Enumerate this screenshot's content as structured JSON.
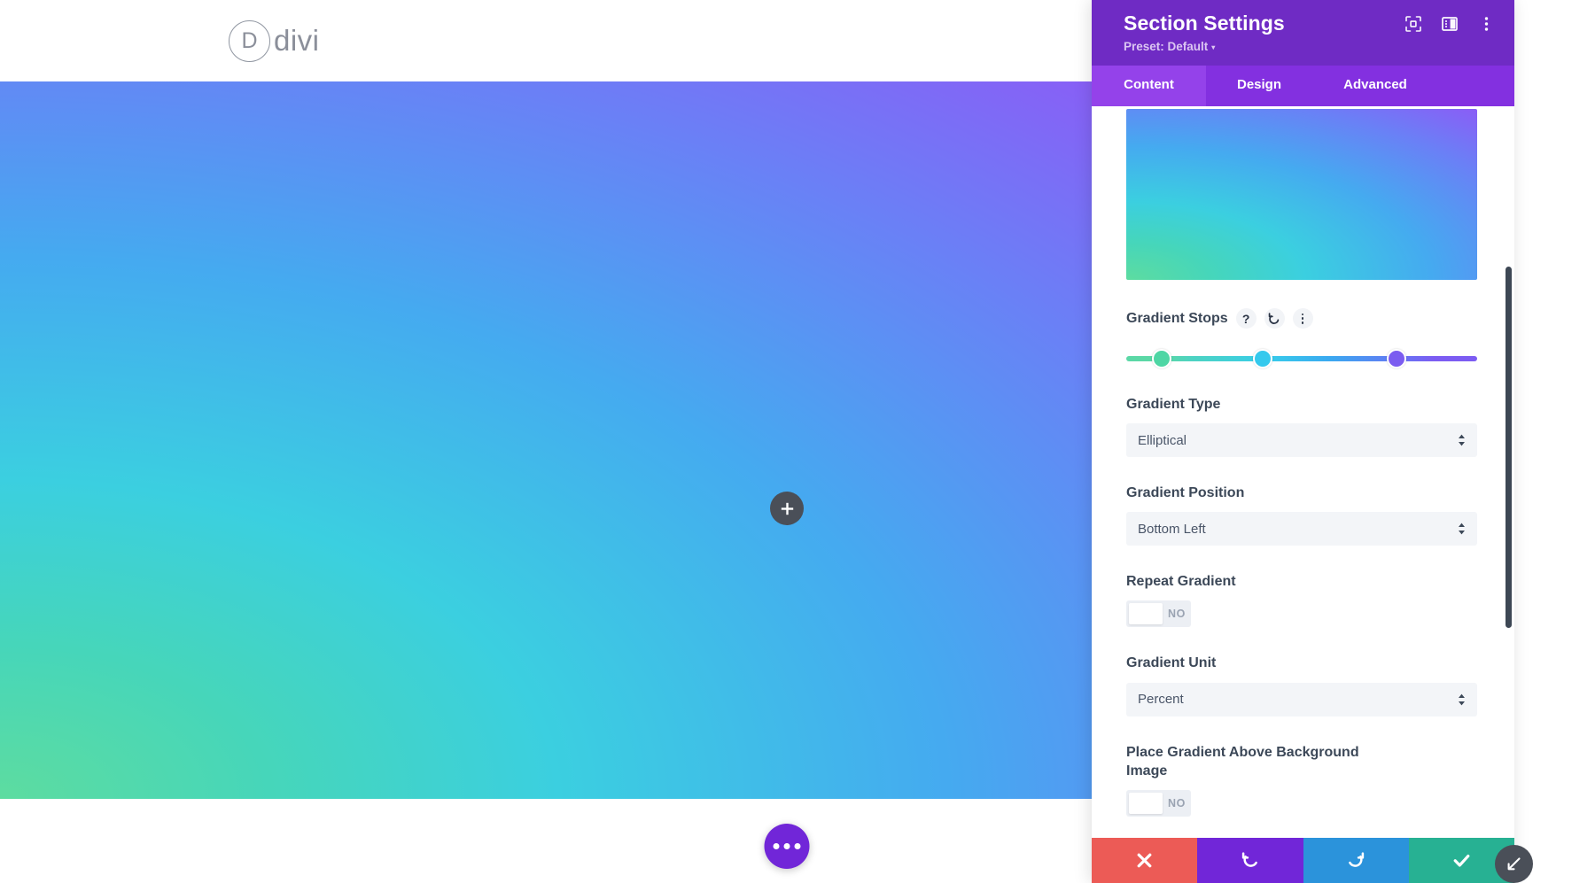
{
  "site": {
    "logo_letter": "D",
    "logo_text": "divi",
    "add_section_icon": "plus-icon",
    "page_settings_icon": "ellipsis-icon"
  },
  "modal": {
    "title": "Section Settings",
    "preset_label": "Preset: Default",
    "preset_caret": "▾",
    "header_icons": [
      {
        "name": "focus-target-icon"
      },
      {
        "name": "layout-panel-icon"
      },
      {
        "name": "vertical-dots-icon"
      }
    ],
    "tabs": [
      {
        "label": "Content",
        "active": true
      },
      {
        "label": "Design",
        "active": false
      },
      {
        "label": "Advanced",
        "active": false
      }
    ],
    "theme": {
      "header_bg": "#6f2bc4",
      "tabbar_bg": "#8330e0",
      "tab_active_bg": "#9442ea",
      "preset_text": "#dcc6f2"
    }
  },
  "gradient": {
    "preview_name": "gradient-preview-swatch",
    "stops_label": "Gradient Stops",
    "help_glyph": "?",
    "reset_glyph": "↺",
    "stops": [
      {
        "position_pct": 10,
        "color": "#4ed6a4"
      },
      {
        "position_pct": 39,
        "color": "#35c9ed"
      },
      {
        "position_pct": 77,
        "color": "#7b5cf0"
      }
    ],
    "type_label": "Gradient Type",
    "type_value": "Elliptical",
    "position_label": "Gradient Position",
    "position_value": "Bottom Left",
    "repeat_label": "Repeat Gradient",
    "repeat_value": "NO",
    "unit_label": "Gradient Unit",
    "unit_value": "Percent",
    "above_image_label": "Place Gradient Above Background Image",
    "above_image_value": "NO"
  },
  "actions": [
    {
      "name": "discard-button",
      "icon": "close-icon",
      "color": "#ec5b56"
    },
    {
      "name": "undo-button",
      "icon": "undo-icon",
      "color": "#7126d8"
    },
    {
      "name": "redo-button",
      "icon": "redo-icon",
      "color": "#2b93db"
    },
    {
      "name": "save-button",
      "icon": "check-icon",
      "color": "#27b193"
    }
  ],
  "resize": {
    "icon": "resize-diagonal-icon"
  }
}
